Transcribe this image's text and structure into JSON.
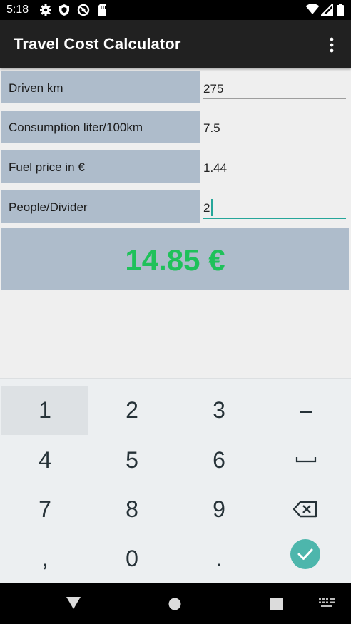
{
  "status_bar": {
    "time": "5:18",
    "left_icons": [
      "settings-icon",
      "shield-icon",
      "no-sync-icon",
      "sd-card-icon"
    ],
    "right_icons": [
      "wifi-icon",
      "signal-icon",
      "battery-icon"
    ]
  },
  "app_bar": {
    "title": "Travel Cost Calculator",
    "overflow_icon": "more-vert-icon"
  },
  "form": {
    "driven": {
      "label": "Driven km",
      "value": "275"
    },
    "consumption": {
      "label": "Consumption liter/100km",
      "value": "7.5"
    },
    "fuel_price": {
      "label": "Fuel price in €",
      "value": "1.44"
    },
    "people": {
      "label": "People/Divider",
      "value": "2"
    }
  },
  "result": {
    "amount": "14.85 €",
    "color": "#1fc15a"
  },
  "keyboard": {
    "keys": [
      {
        "label": "1"
      },
      {
        "label": "2"
      },
      {
        "label": "3"
      },
      {
        "label": "–"
      },
      {
        "label": "4"
      },
      {
        "label": "5"
      },
      {
        "label": "6"
      },
      {
        "icon": "space-icon"
      },
      {
        "label": "7"
      },
      {
        "label": "8"
      },
      {
        "label": "9"
      },
      {
        "icon": "backspace-icon"
      },
      {
        "label": ","
      },
      {
        "label": "0"
      },
      {
        "label": "."
      },
      {
        "icon": "done-check-icon"
      }
    ],
    "accent_color": "#26a69a"
  },
  "nav_bar": {
    "icons": [
      "back-icon",
      "home-icon",
      "recents-icon",
      "keyboard-switch-icon"
    ]
  }
}
